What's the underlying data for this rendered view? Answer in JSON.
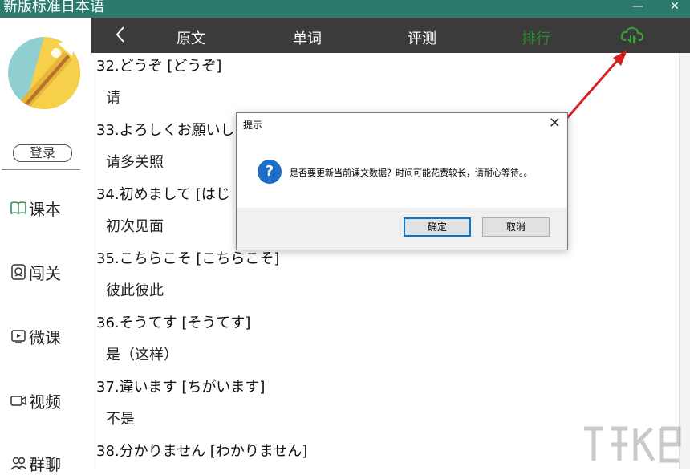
{
  "window": {
    "title": "新版标准日本语",
    "minimize": "—",
    "close": "✕"
  },
  "sidebar": {
    "login": "登录",
    "items": [
      {
        "label": "课本",
        "icon": "book-icon"
      },
      {
        "label": "闯关",
        "icon": "badge-icon"
      },
      {
        "label": "微课",
        "icon": "play-icon"
      },
      {
        "label": "视频",
        "icon": "video-icon"
      },
      {
        "label": "群聊",
        "icon": "group-icon"
      }
    ]
  },
  "header": {
    "tabs": [
      {
        "label": "原文"
      },
      {
        "label": "单词"
      },
      {
        "label": "评测"
      },
      {
        "label": "排行"
      }
    ],
    "cloud_icon": "cloud-sync-icon"
  },
  "vocab": [
    {
      "word": "32.どうぞ [どうぞ]",
      "meaning": "请"
    },
    {
      "word": "33.よろしくお願いし",
      "meaning": "请多关照"
    },
    {
      "word": "34.初めまして [はじ",
      "meaning": "初次见面"
    },
    {
      "word": "35.こちらこそ [こちらこそ]",
      "meaning": "彼此彼此"
    },
    {
      "word": "36.そうてす [そうてす]",
      "meaning": "是（这样）"
    },
    {
      "word": "37.違います [ちがいます]",
      "meaning": "不是"
    },
    {
      "word": "38.分かりません [わかりません]",
      "meaning": ""
    }
  ],
  "dialog": {
    "title": "提示",
    "close": "✕",
    "icon_glyph": "?",
    "message": "是否要更新当前课文数据？时间可能花费较长，请耐心等待。。",
    "ok": "确定",
    "cancel": "取消"
  },
  "colors": {
    "titlebar": "#2b7a6c",
    "header": "#3b3b3b",
    "ranking_tab": "#2a8a2a",
    "arrow": "#d42020",
    "question_icon": "#1e6ec8"
  }
}
